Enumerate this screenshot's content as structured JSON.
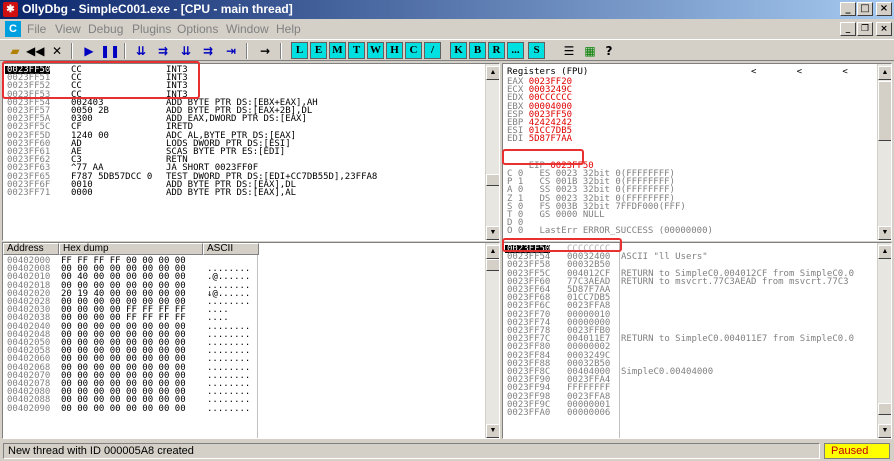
{
  "window": {
    "title": "OllyDbg - SimpleC001.exe - [CPU - main thread]",
    "app_icon": "bug-icon"
  },
  "menu": {
    "c_label": "C",
    "items": [
      "File",
      "View",
      "Debug",
      "Plugins",
      "Options",
      "Window",
      "Help"
    ]
  },
  "toolbar": {
    "letters": [
      "L",
      "E",
      "M",
      "T",
      "W",
      "H",
      "C",
      "/",
      "K",
      "B",
      "R",
      "...",
      "S"
    ]
  },
  "disasm": {
    "rows": [
      {
        "addr": "0023FF50",
        "hex": "CC",
        "instr": "INT3",
        "selected": true
      },
      {
        "addr": "0023FF51",
        "hex": "CC",
        "instr": "INT3"
      },
      {
        "addr": "0023FF52",
        "hex": "CC",
        "instr": "INT3"
      },
      {
        "addr": "0023FF53",
        "hex": "CC",
        "instr": "INT3"
      },
      {
        "addr": "0023FF54",
        "hex": "002403",
        "instr": "ADD BYTE PTR DS:[EBX+EAX],AH"
      },
      {
        "addr": "0023FF57",
        "hex": "0050 2B",
        "instr": "ADD BYTE PTR DS:[EAX+2B],DL"
      },
      {
        "addr": "0023FF5A",
        "hex": "0300",
        "instr": "ADD EAX,DWORD PTR DS:[EAX]"
      },
      {
        "addr": "0023FF5C",
        "hex": "CF",
        "instr": "IRETD"
      },
      {
        "addr": "0023FF5D",
        "hex": "1240 00",
        "instr": "ADC AL,BYTE PTR DS:[EAX]"
      },
      {
        "addr": "0023FF60",
        "hex": "AD",
        "instr": "LODS DWORD PTR DS:[ESI]"
      },
      {
        "addr": "0023FF61",
        "hex": "AE",
        "instr": "SCAS BYTE PTR ES:[EDI]"
      },
      {
        "addr": "0023FF62",
        "hex": "C3",
        "instr": "RETN"
      },
      {
        "addr": "0023FF63",
        "hex": "^77 AA",
        "instr": "JA SHORT 0023FF0F"
      },
      {
        "addr": "0023FF65",
        "hex": "F787 5DB57DCC 0",
        "instr": "TEST DWORD PTR DS:[EDI+CC7DB55D],23FFA8"
      },
      {
        "addr": "0023FF6F",
        "hex": "0010",
        "instr": "ADD BYTE PTR DS:[EAX],DL"
      },
      {
        "addr": "0023FF71",
        "hex": "0000",
        "instr": "ADD BYTE PTR DS:[EAX],AL"
      }
    ]
  },
  "registers": {
    "header": "Registers (FPU)",
    "nav": "<   <   <   <   <",
    "gp": [
      {
        "name": "EAX",
        "value": "0023FF20"
      },
      {
        "name": "ECX",
        "value": "0003249C"
      },
      {
        "name": "EDX",
        "value": "00CCCCCC"
      },
      {
        "name": "EBX",
        "value": "00004000"
      },
      {
        "name": "ESP",
        "value": "0023FF50"
      },
      {
        "name": "EBP",
        "value": "42424242"
      },
      {
        "name": "ESI",
        "value": "01CC7DB5"
      },
      {
        "name": "EDI",
        "value": "5D87F7AA"
      }
    ],
    "eip": {
      "name": "EIP",
      "value": "0023FF50"
    },
    "flags": [
      "C 0   ES 0023 32bit 0(FFFFFFFF)",
      "P 1   CS 001B 32bit 0(FFFFFFFF)",
      "A 0   SS 0023 32bit 0(FFFFFFFF)",
      "Z 1   DS 0023 32bit 0(FFFFFFFF)",
      "S 0   FS 003B 32bit 7FFDF000(FFF)",
      "T 0   GS 0000 NULL",
      "D 0",
      "O 0   LastErr ERROR_SUCCESS (00000000)"
    ]
  },
  "dump": {
    "headers": {
      "address": "Address",
      "hex": "Hex dump",
      "ascii": "ASCII"
    },
    "rows": [
      {
        "addr": "00402000",
        "hex": "FF FF FF FF 00 00 00 00",
        "ascii": ""
      },
      {
        "addr": "00402008",
        "hex": "00 00 00 00 00 00 00 00",
        "ascii": "........"
      },
      {
        "addr": "00402010",
        "hex": "00 40 00 00 00 00 00 00",
        "ascii": ".@......"
      },
      {
        "addr": "00402018",
        "hex": "00 00 00 00 00 00 00 00",
        "ascii": "........"
      },
      {
        "addr": "00402020",
        "hex": "20 19 40 00 00 00 00 00",
        "ascii": "↓@......"
      },
      {
        "addr": "00402028",
        "hex": "00 00 00 00 00 00 00 00",
        "ascii": "........"
      },
      {
        "addr": "00402030",
        "hex": "00 00 00 00 FF FF FF FF",
        "ascii": "...."
      },
      {
        "addr": "00402038",
        "hex": "00 00 00 00 FF FF FF FF",
        "ascii": "...."
      },
      {
        "addr": "00402040",
        "hex": "00 00 00 00 00 00 00 00",
        "ascii": "........"
      },
      {
        "addr": "00402048",
        "hex": "00 00 00 00 00 00 00 00",
        "ascii": "........"
      },
      {
        "addr": "00402050",
        "hex": "00 00 00 00 00 00 00 00",
        "ascii": "........"
      },
      {
        "addr": "00402058",
        "hex": "00 00 00 00 00 00 00 00",
        "ascii": "........"
      },
      {
        "addr": "00402060",
        "hex": "00 00 00 00 00 00 00 00",
        "ascii": "........"
      },
      {
        "addr": "00402068",
        "hex": "00 00 00 00 00 00 00 00",
        "ascii": "........"
      },
      {
        "addr": "00402070",
        "hex": "00 00 00 00 00 00 00 00",
        "ascii": "........"
      },
      {
        "addr": "00402078",
        "hex": "00 00 00 00 00 00 00 00",
        "ascii": "........"
      },
      {
        "addr": "00402080",
        "hex": "00 00 00 00 00 00 00 00",
        "ascii": "........"
      },
      {
        "addr": "00402088",
        "hex": "00 00 00 00 00 00 00 00",
        "ascii": "........"
      },
      {
        "addr": "00402090",
        "hex": "00 00 00 00 00 00 00 00",
        "ascii": "........"
      }
    ]
  },
  "stack": {
    "rows": [
      {
        "addr": "0023FF50",
        "value": "CCCCCCCC",
        "comment": "",
        "selected": true
      },
      {
        "addr": "0023FF54",
        "value": "00032400",
        "comment": "ASCII \"ll Users\""
      },
      {
        "addr": "0023FF58",
        "value": "00032B50",
        "comment": ""
      },
      {
        "addr": "0023FF5C",
        "value": "004012CF",
        "comment": "RETURN to SimpleC0.004012CF from SimpleC0.0"
      },
      {
        "addr": "0023FF60",
        "value": "77C3AEAD",
        "comment": "RETURN to msvcrt.77C3AEAD from msvcrt.77C3"
      },
      {
        "addr": "0023FF64",
        "value": "5D87F7AA",
        "comment": ""
      },
      {
        "addr": "0023FF68",
        "value": "01CC7DB5",
        "comment": ""
      },
      {
        "addr": "0023FF6C",
        "value": "0023FFA8",
        "comment": ""
      },
      {
        "addr": "0023FF70",
        "value": "00000010",
        "comment": ""
      },
      {
        "addr": "0023FF74",
        "value": "00000000",
        "comment": ""
      },
      {
        "addr": "0023FF78",
        "value": "0023FFB0",
        "comment": ""
      },
      {
        "addr": "0023FF7C",
        "value": "004011E7",
        "comment": "RETURN to SimpleC0.004011E7 from SimpleC0.0"
      },
      {
        "addr": "0023FF80",
        "value": "00000002",
        "comment": ""
      },
      {
        "addr": "0023FF84",
        "value": "0003249C",
        "comment": ""
      },
      {
        "addr": "0023FF88",
        "value": "00032B50",
        "comment": ""
      },
      {
        "addr": "0023FF8C",
        "value": "00404000",
        "comment": "SimpleC0.00404000"
      },
      {
        "addr": "0023FF90",
        "value": "0023FFA4",
        "comment": ""
      },
      {
        "addr": "0023FF94",
        "value": "FFFFFFFF",
        "comment": ""
      },
      {
        "addr": "0023FF98",
        "value": "0023FFA8",
        "comment": ""
      },
      {
        "addr": "0023FF9C",
        "value": "00000001",
        "comment": ""
      },
      {
        "addr": "0023FFA0",
        "value": "00000006",
        "comment": ""
      }
    ]
  },
  "status": {
    "message": "New thread with ID 000005A8 created",
    "state": "Paused"
  },
  "colors": {
    "highlight": "#e83030",
    "register_changed": "#e00000",
    "selected_row_bg": "#000000",
    "paused_bg": "#ffff00"
  }
}
